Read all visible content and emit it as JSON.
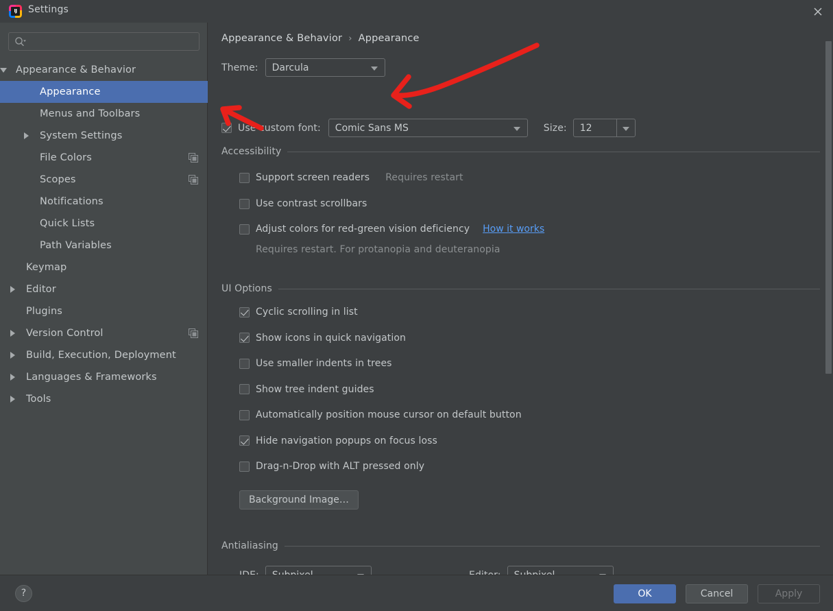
{
  "window": {
    "title": "Settings",
    "app_icon": "intellij-idea-icon",
    "icon_text": "IJ",
    "close_icon": "close-icon"
  },
  "sidebar": {
    "search": {
      "placeholder": "",
      "value": "",
      "icon": "search-icon"
    },
    "items": [
      {
        "label": "Appearance & Behavior",
        "twisty": "down",
        "indent": 23,
        "selected": false,
        "copy": false
      },
      {
        "label": "Appearance",
        "twisty": "none",
        "indent": 58,
        "selected": true,
        "copy": false
      },
      {
        "label": "Menus and Toolbars",
        "twisty": "none",
        "indent": 58,
        "selected": false,
        "copy": false
      },
      {
        "label": "System Settings",
        "twisty": "right",
        "indent": 58,
        "selected": false,
        "copy": false
      },
      {
        "label": "File Colors",
        "twisty": "none",
        "indent": 58,
        "selected": false,
        "copy": true
      },
      {
        "label": "Scopes",
        "twisty": "none",
        "indent": 58,
        "selected": false,
        "copy": true
      },
      {
        "label": "Notifications",
        "twisty": "none",
        "indent": 58,
        "selected": false,
        "copy": false
      },
      {
        "label": "Quick Lists",
        "twisty": "none",
        "indent": 58,
        "selected": false,
        "copy": false
      },
      {
        "label": "Path Variables",
        "twisty": "none",
        "indent": 58,
        "selected": false,
        "copy": false
      },
      {
        "label": "Keymap",
        "twisty": "none",
        "indent": 38,
        "selected": false,
        "copy": false
      },
      {
        "label": "Editor",
        "twisty": "right",
        "indent": 38,
        "selected": false,
        "copy": false
      },
      {
        "label": "Plugins",
        "twisty": "none",
        "indent": 38,
        "selected": false,
        "copy": false
      },
      {
        "label": "Version Control",
        "twisty": "right",
        "indent": 38,
        "selected": false,
        "copy": true
      },
      {
        "label": "Build, Execution, Deployment",
        "twisty": "right",
        "indent": 38,
        "selected": false,
        "copy": false
      },
      {
        "label": "Languages & Frameworks",
        "twisty": "right",
        "indent": 38,
        "selected": false,
        "copy": false
      },
      {
        "label": "Tools",
        "twisty": "right",
        "indent": 38,
        "selected": false,
        "copy": false
      }
    ]
  },
  "main": {
    "breadcrumb": {
      "parent": "Appearance & Behavior",
      "separator": "›",
      "current": "Appearance"
    },
    "theme": {
      "label": "Theme:",
      "value": "Darcula"
    },
    "custom_font": {
      "checkbox_label": "Use custom font:",
      "checked": true,
      "font_value": "Comic Sans MS",
      "size_label": "Size:",
      "size_value": "12"
    },
    "accessibility": {
      "title": "Accessibility",
      "options": [
        {
          "label": "Support screen readers",
          "checked": false,
          "note": "Requires restart",
          "link": ""
        },
        {
          "label": "Use contrast scrollbars",
          "checked": false,
          "note": "",
          "link": ""
        },
        {
          "label": "Adjust colors for red-green vision deficiency",
          "checked": false,
          "note": "",
          "link": "How it works"
        }
      ],
      "footnote": "Requires restart. For protanopia and deuteranopia"
    },
    "ui_options": {
      "title": "UI Options",
      "options": [
        {
          "label": "Cyclic scrolling in list",
          "checked": true
        },
        {
          "label": "Show icons in quick navigation",
          "checked": true
        },
        {
          "label": "Use smaller indents in trees",
          "checked": false
        },
        {
          "label": "Show tree indent guides",
          "checked": false
        },
        {
          "label": "Automatically position mouse cursor on default button",
          "checked": false
        },
        {
          "label": "Hide navigation popups on focus loss",
          "checked": true
        },
        {
          "label": "Drag-n-Drop with ALT pressed only",
          "checked": false
        }
      ],
      "background_image_button": "Background Image…"
    },
    "antialiasing": {
      "title": "Antialiasing",
      "ide_label": "IDE:",
      "ide_value": "Subpixel",
      "editor_label": "Editor:",
      "editor_value": "Subpixel"
    }
  },
  "footer": {
    "help_label": "?",
    "ok_label": "OK",
    "cancel_label": "Cancel",
    "apply_label": "Apply",
    "apply_disabled": true
  },
  "annotations": {
    "color": "#e8211b",
    "arrow_font_label": "arrow pointing to custom font dropdown",
    "arrow_checkbox_label": "arrow pointing to use custom font checkbox"
  },
  "colors": {
    "window_bg": "#3c3f41",
    "sidebar_bg": "#45494a",
    "selection": "#4b6eaf",
    "link": "#589df6",
    "annotation_red": "#e8211b"
  }
}
